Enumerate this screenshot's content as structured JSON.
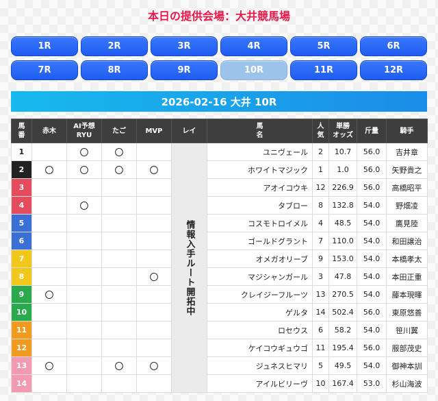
{
  "venue_title": "本日の提供会場：大井競馬場",
  "races": [
    {
      "label": "1R",
      "active": false
    },
    {
      "label": "2R",
      "active": false
    },
    {
      "label": "3R",
      "active": false
    },
    {
      "label": "4R",
      "active": false
    },
    {
      "label": "5R",
      "active": false
    },
    {
      "label": "6R",
      "active": false
    },
    {
      "label": "7R",
      "active": false
    },
    {
      "label": "8R",
      "active": false
    },
    {
      "label": "9R",
      "active": false
    },
    {
      "label": "10R",
      "active": true
    },
    {
      "label": "11R",
      "active": false
    },
    {
      "label": "12R",
      "active": false
    }
  ],
  "race_header": "2026-02-16 大井 10R",
  "table": {
    "headers": {
      "umaban": "馬\n番",
      "akaki": "赤木",
      "ai": "AI予想\nRYU",
      "tago": "たご",
      "mvp": "MVP",
      "rei": "レイ",
      "horse": "馬\n名",
      "ninki": "人\n気",
      "odds": "単勝\nオッズ",
      "kinryo": "斤量",
      "jockey": "騎手"
    },
    "rei_note": "情報入手ルート開拓中",
    "mark_symbol": "〇",
    "rows": [
      {
        "no": "1",
        "color": "bw",
        "akaki": false,
        "ai": true,
        "tago": true,
        "mvp": false,
        "horse": "ユニヴェール",
        "ninki": "2",
        "odds": "10.7",
        "kinryo": "56.0",
        "jockey": "吉井章"
      },
      {
        "no": "2",
        "color": "bk",
        "akaki": true,
        "ai": true,
        "tago": true,
        "mvp": true,
        "horse": "ホワイトマジック",
        "ninki": "1",
        "odds": "1.0",
        "kinryo": "56.0",
        "jockey": "矢野貴之"
      },
      {
        "no": "3",
        "color": "rd",
        "akaki": false,
        "ai": false,
        "tago": false,
        "mvp": false,
        "horse": "アオイコウキ",
        "ninki": "12",
        "odds": "226.9",
        "kinryo": "56.0",
        "jockey": "高橋昭平"
      },
      {
        "no": "4",
        "color": "rd",
        "akaki": false,
        "ai": true,
        "tago": false,
        "mvp": false,
        "horse": "タブロー",
        "ninki": "8",
        "odds": "132.8",
        "kinryo": "54.0",
        "jockey": "野畑凌"
      },
      {
        "no": "5",
        "color": "bl",
        "akaki": false,
        "ai": false,
        "tago": false,
        "mvp": false,
        "horse": "コスモトロイメル",
        "ninki": "4",
        "odds": "48.5",
        "kinryo": "54.0",
        "jockey": "鷹見陸"
      },
      {
        "no": "6",
        "color": "bl",
        "akaki": false,
        "ai": false,
        "tago": false,
        "mvp": false,
        "horse": "ゴールドグラント",
        "ninki": "7",
        "odds": "110.0",
        "kinryo": "54.0",
        "jockey": "和田譲治"
      },
      {
        "no": "7",
        "color": "yl",
        "akaki": false,
        "ai": false,
        "tago": false,
        "mvp": false,
        "horse": "オメガオリーブ",
        "ninki": "9",
        "odds": "153.0",
        "kinryo": "54.0",
        "jockey": "本橋孝太"
      },
      {
        "no": "8",
        "color": "yl",
        "akaki": false,
        "ai": false,
        "tago": false,
        "mvp": true,
        "horse": "マジシャンガール",
        "ninki": "3",
        "odds": "47.8",
        "kinryo": "54.0",
        "jockey": "本田正重"
      },
      {
        "no": "9",
        "color": "gr",
        "akaki": true,
        "ai": false,
        "tago": false,
        "mvp": false,
        "horse": "クレイジーフルーツ",
        "ninki": "13",
        "odds": "270.5",
        "kinryo": "54.0",
        "jockey": "藤本現暉"
      },
      {
        "no": "10",
        "color": "gr",
        "akaki": false,
        "ai": false,
        "tago": false,
        "mvp": false,
        "horse": "ゲルタ",
        "ninki": "14",
        "odds": "502.4",
        "kinryo": "56.0",
        "jockey": "東原悠善"
      },
      {
        "no": "11",
        "color": "or",
        "akaki": false,
        "ai": false,
        "tago": false,
        "mvp": false,
        "horse": "ロセウス",
        "ninki": "6",
        "odds": "58.2",
        "kinryo": "54.0",
        "jockey": "笹川翼"
      },
      {
        "no": "12",
        "color": "or",
        "akaki": false,
        "ai": false,
        "tago": false,
        "mvp": false,
        "horse": "ケイコウギュウゴ",
        "ninki": "11",
        "odds": "195.4",
        "kinryo": "56.0",
        "jockey": "服部茂史"
      },
      {
        "no": "13",
        "color": "pk",
        "akaki": true,
        "ai": false,
        "tago": true,
        "mvp": true,
        "horse": "ジュネスヒマリ",
        "ninki": "5",
        "odds": "49.5",
        "kinryo": "54.0",
        "jockey": "御神本訓"
      },
      {
        "no": "14",
        "color": "pk",
        "akaki": false,
        "ai": false,
        "tago": false,
        "mvp": false,
        "horse": "アイルビリーヴ",
        "ninki": "10",
        "odds": "167.4",
        "kinryo": "53.0",
        "jockey": "杉山海波"
      }
    ]
  }
}
